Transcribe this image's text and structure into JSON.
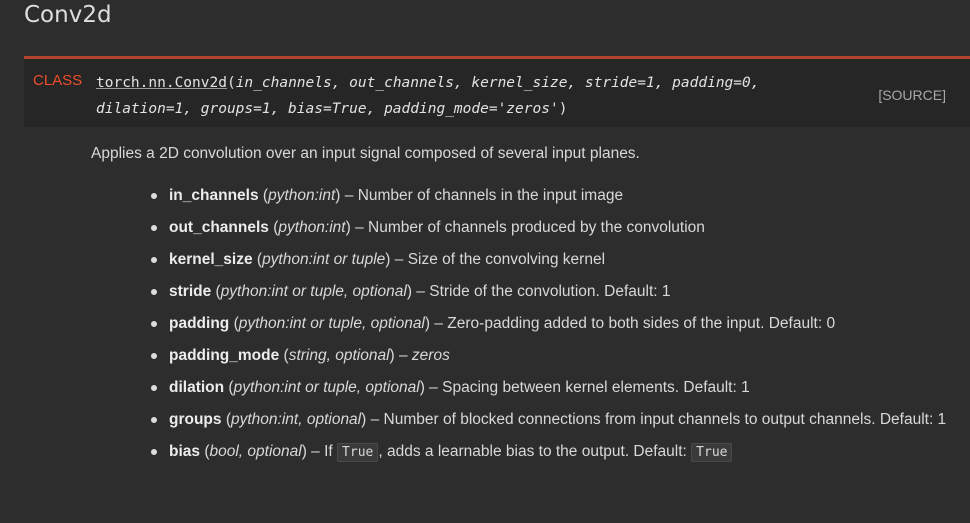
{
  "page": {
    "title": "Conv2d"
  },
  "signature": {
    "label": "CLASS",
    "name": "torch.nn.Conv2d",
    "open_paren": "(",
    "line1_params": "in_channels, out_channels, kernel_size, stride=1, padding=0,",
    "line2_params": "dilation=1, groups=1, bias=True, padding_mode='zeros'",
    "close_paren": ")",
    "source_link": "[SOURCE]"
  },
  "description": "Applies a 2D convolution over an input signal composed of several input planes.",
  "params": [
    {
      "name": "in_channels",
      "type": "python:int",
      "desc": "Number of channels in the input image"
    },
    {
      "name": "out_channels",
      "type": "python:int",
      "desc": "Number of channels produced by the convolution"
    },
    {
      "name": "kernel_size",
      "type": "python:int or tuple",
      "desc": "Size of the convolving kernel"
    },
    {
      "name": "stride",
      "type": "python:int or tuple, optional",
      "desc": "Stride of the convolution. Default: 1"
    },
    {
      "name": "padding",
      "type": "python:int or tuple, optional",
      "desc": "Zero-padding added to both sides of the input. Default: 0"
    },
    {
      "name": "padding_mode",
      "type": "string, optional",
      "desc": "zeros"
    },
    {
      "name": "dilation",
      "type": "python:int or tuple, optional",
      "desc": "Spacing between kernel elements. Default: 1"
    },
    {
      "name": "groups",
      "type": "python:int, optional",
      "desc": "Number of blocked connections from input channels to output channels. Default: 1"
    },
    {
      "name": "bias",
      "type": "bool, optional",
      "desc_prefix": "If",
      "desc_code1": "True",
      "desc_middle": ", adds a learnable bias to the output. Default:",
      "desc_code2": "True"
    }
  ],
  "colors": {
    "accent": "#ee4c2c",
    "background": "#2d2d2d",
    "signature_background": "#262626"
  }
}
